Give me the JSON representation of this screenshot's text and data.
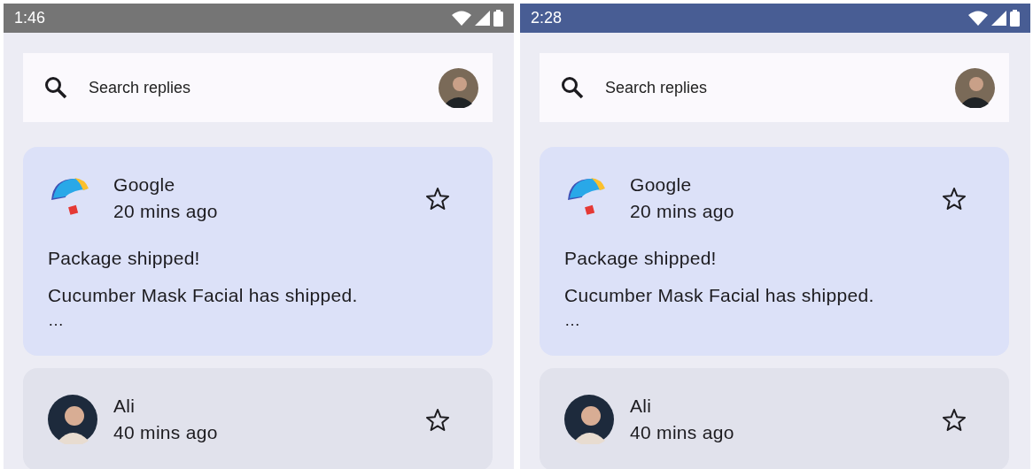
{
  "screens": [
    {
      "status_bar": {
        "time": "1:46",
        "color": "#757575"
      },
      "search": {
        "placeholder": "Search replies"
      },
      "emails": [
        {
          "sender": "Google",
          "time": "20 mins ago",
          "kind": "logo",
          "subject": "Package shipped!",
          "preview": "Cucumber Mask Facial has shipped.",
          "more": "…",
          "starred": false,
          "selected": true
        },
        {
          "sender": "Ali",
          "time": "40 mins ago",
          "kind": "person",
          "starred": false,
          "selected": false
        }
      ]
    },
    {
      "status_bar": {
        "time": "2:28",
        "color": "#485d94"
      },
      "search": {
        "placeholder": "Search replies"
      },
      "emails": [
        {
          "sender": "Google",
          "time": "20 mins ago",
          "kind": "logo",
          "subject": "Package shipped!",
          "preview": "Cucumber Mask Facial has shipped.",
          "more": "…",
          "starred": false,
          "selected": true
        },
        {
          "sender": "Ali",
          "time": "40 mins ago",
          "kind": "person",
          "starred": false,
          "selected": false
        }
      ]
    }
  ]
}
